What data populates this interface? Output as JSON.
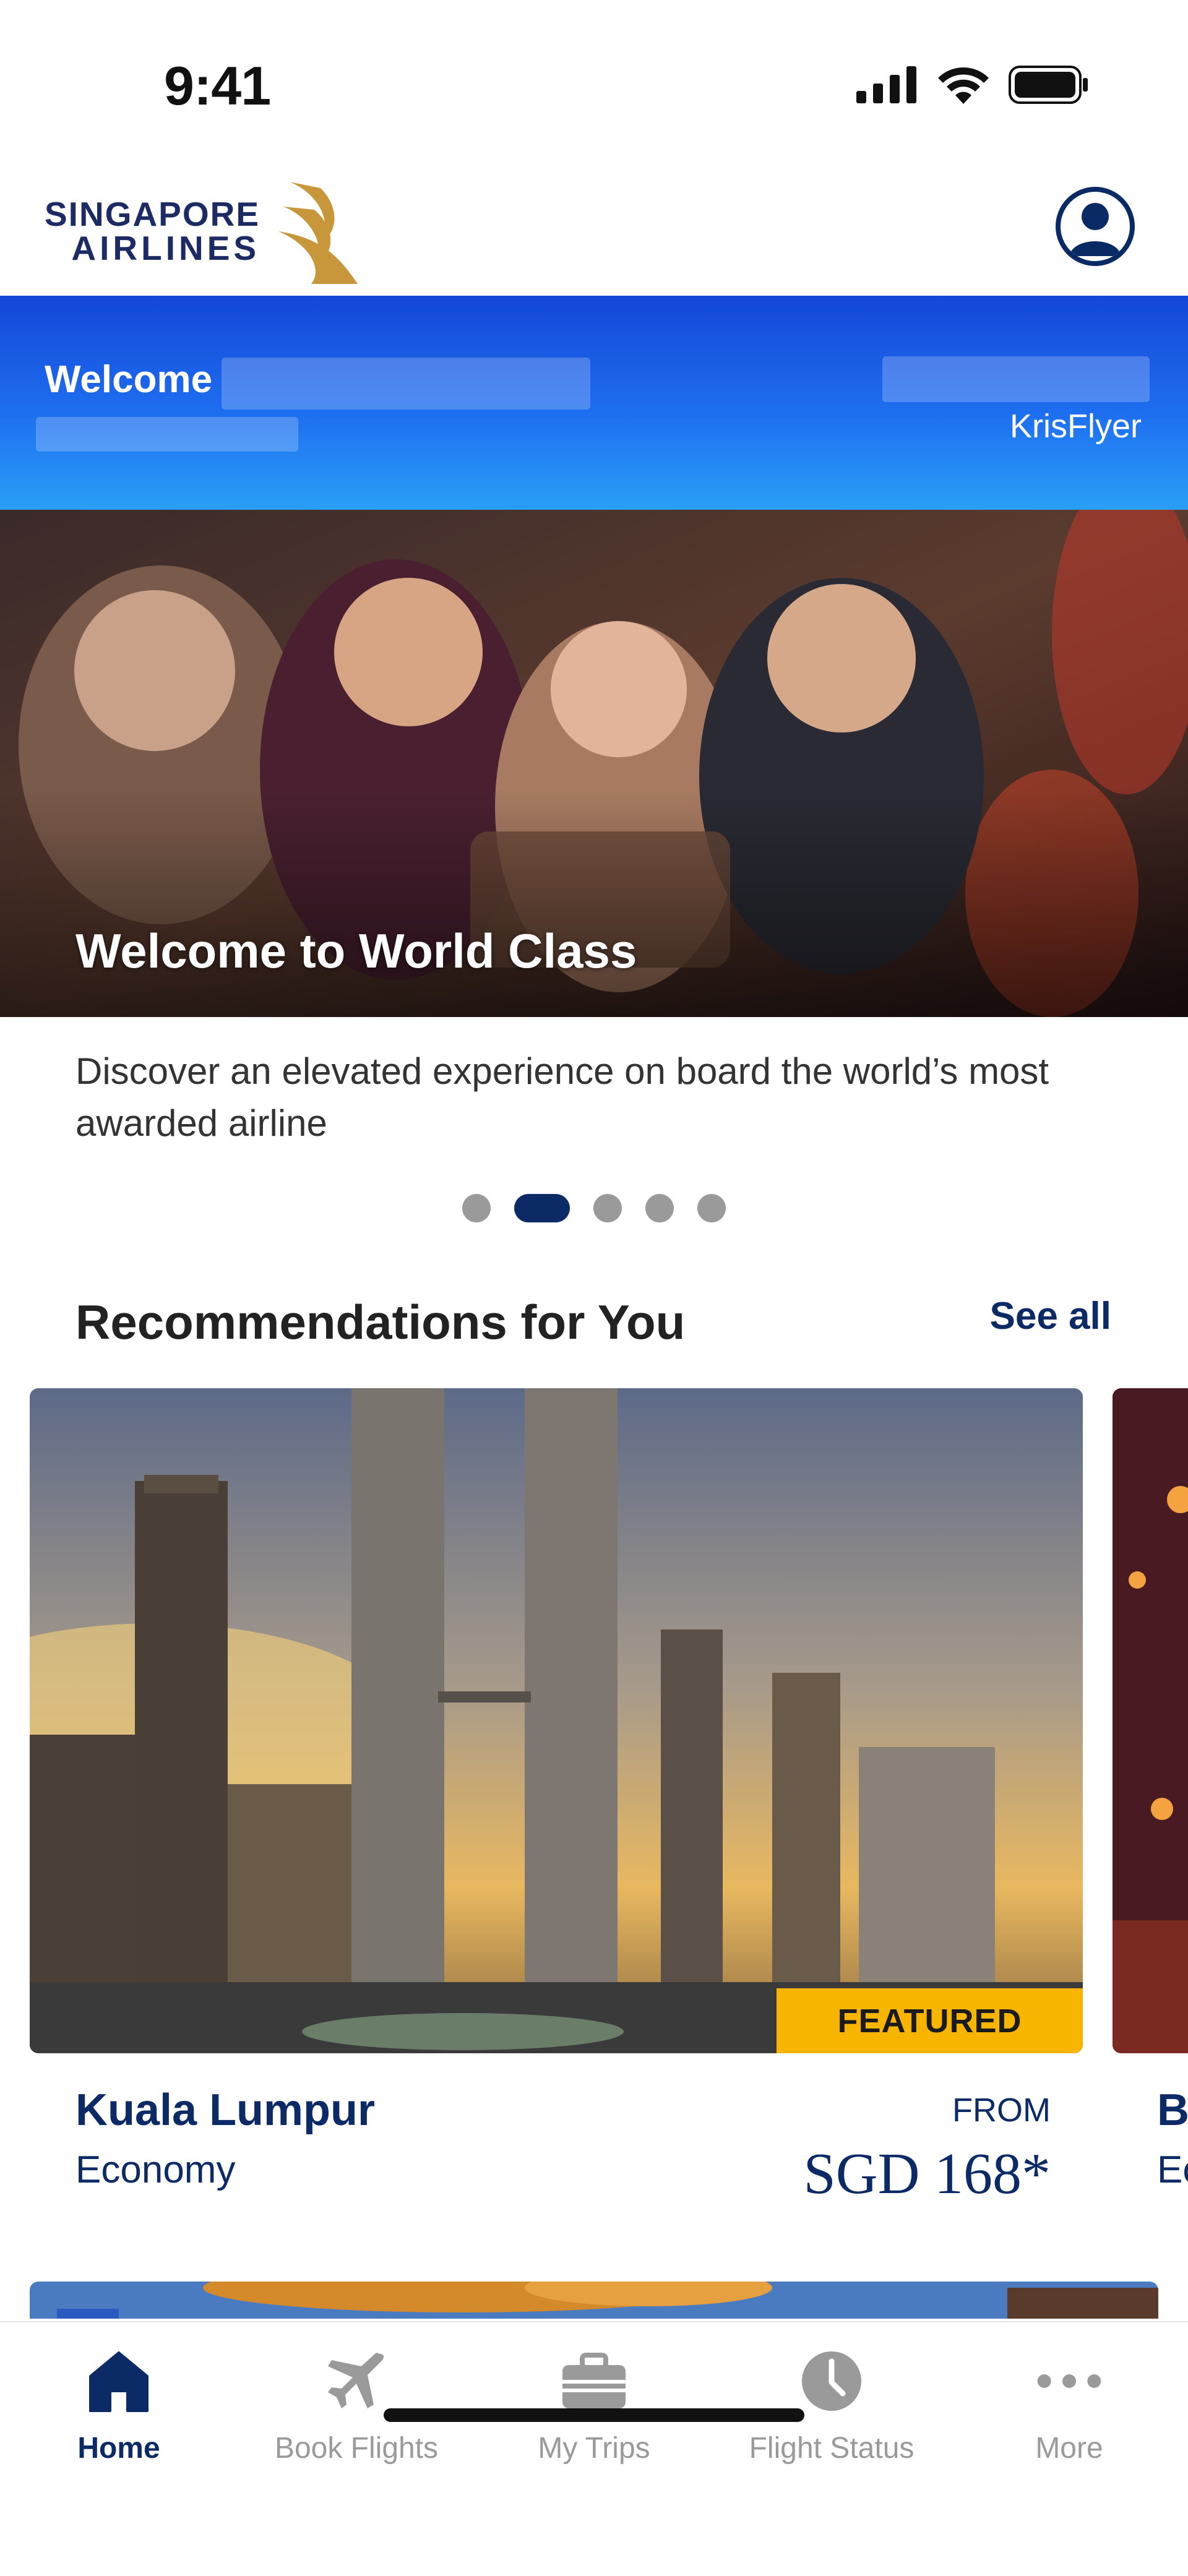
{
  "status_bar": {
    "time": "9:41"
  },
  "header": {
    "logo_line1": "SINGAPORE",
    "logo_line2": "AIRLINES",
    "profile_icon": "user-circle-icon"
  },
  "welcome": {
    "greeting": "Welcome",
    "program": "KrisFlyer"
  },
  "hero": {
    "title": "Welcome to World Class",
    "description": "Discover an elevated experience on board the world’s most awarded airline",
    "slide_count": 5,
    "active_slide": 2
  },
  "recommendations": {
    "title": "Recommendations for You",
    "see_all": "See all",
    "cards": [
      {
        "badge": "FEATURED",
        "city": "Kuala Lumpur",
        "cabin": "Economy",
        "from_label": "FROM",
        "price": "SGD 168*"
      },
      {
        "city": "B",
        "cabin": "Ec"
      }
    ]
  },
  "bottom_nav": {
    "items": [
      {
        "label": "Home",
        "icon": "home-icon",
        "active": true
      },
      {
        "label": "Book Flights",
        "icon": "airplane-icon",
        "active": false
      },
      {
        "label": "My Trips",
        "icon": "briefcase-icon",
        "active": false
      },
      {
        "label": "Flight Status",
        "icon": "clock-icon",
        "active": false
      },
      {
        "label": "More",
        "icon": "more-dots-icon",
        "active": false
      }
    ]
  },
  "colors": {
    "brand_navy": "#0b2a66",
    "brand_gold": "#c9973b",
    "featured_yellow": "#f7b500",
    "welcome_blue": "#1e6ef0"
  }
}
